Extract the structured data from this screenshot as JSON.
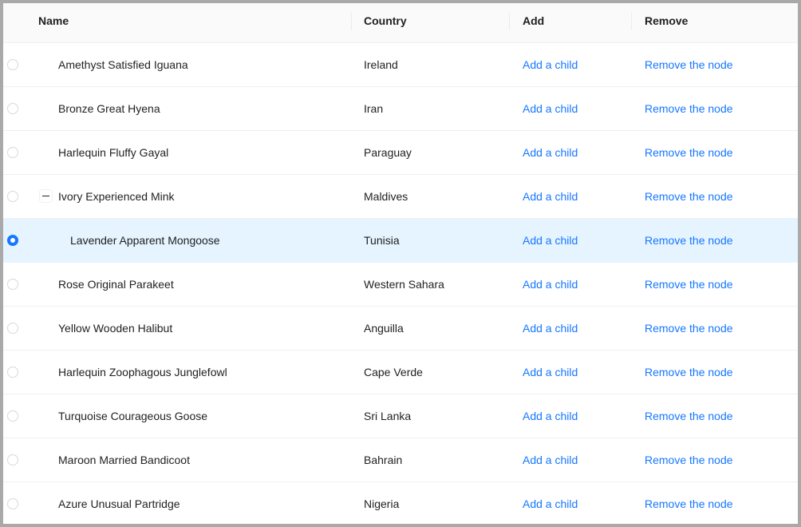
{
  "columns": {
    "name": "Name",
    "country": "Country",
    "add": "Add",
    "remove": "Remove"
  },
  "actions": {
    "add_label": "Add a child",
    "remove_label": "Remove the node"
  },
  "rows": [
    {
      "name": "Amethyst Satisfied Iguana",
      "country": "Ireland"
    },
    {
      "name": "Bronze Great Hyena",
      "country": "Iran"
    },
    {
      "name": "Harlequin Fluffy Gayal",
      "country": "Paraguay"
    },
    {
      "name": "Ivory Experienced Mink",
      "country": "Maldives"
    },
    {
      "name": "Lavender Apparent Mongoose",
      "country": "Tunisia"
    },
    {
      "name": "Rose Original Parakeet",
      "country": "Western Sahara"
    },
    {
      "name": "Yellow Wooden Halibut",
      "country": "Anguilla"
    },
    {
      "name": "Harlequin Zoophagous Junglefowl",
      "country": "Cape Verde"
    },
    {
      "name": "Turquoise Courageous Goose",
      "country": "Sri Lanka"
    },
    {
      "name": "Maroon Married Bandicoot",
      "country": "Bahrain"
    },
    {
      "name": "Azure Unusual Partridge",
      "country": "Nigeria"
    }
  ],
  "colors": {
    "accent": "#1677ff",
    "selected_row": "#e6f4ff",
    "header_bg": "#fafafa"
  }
}
